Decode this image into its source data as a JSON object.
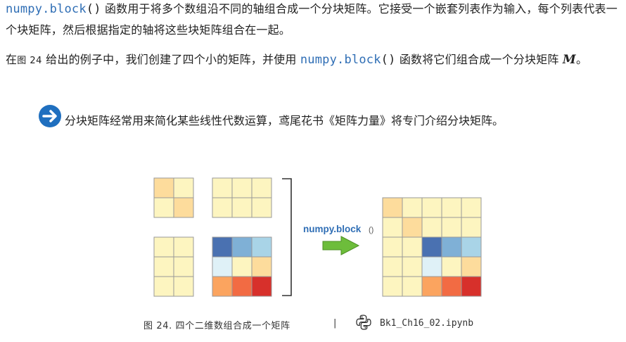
{
  "paragraph1": {
    "code": "numpy.block",
    "paren": "()",
    "text_a": " 函数用于将多个数组沿不同的轴组合成一个分块矩阵。它接受一个嵌套列表作为输入，每个列表代表一个块矩阵，然后根据指定的轴将这些块矩阵组合在一起。"
  },
  "paragraph2": {
    "prefix": "在",
    "fig_ref": "图 24",
    "text_a": " 给出的例子中，我们创建了四个小的矩阵，并使用 ",
    "code": "numpy.block",
    "paren": "()",
    "text_b": " 函数将它们组合成一个分块矩阵 ",
    "math": "M",
    "suffix": "。"
  },
  "note": {
    "icon": "arrow-right-circle-icon",
    "text": "分块矩阵经常用来简化某些线性代数运算，鸢尾花书《矩阵力量》将专门介绍分块矩阵。"
  },
  "figure": {
    "arrow_label_bold": "numpy.block",
    "arrow_label_paren": "()",
    "blocks": {
      "A": [
        [
          "#fddc9c",
          "#fdf5c0"
        ],
        [
          "#fdf5c0",
          "#fddc9c"
        ]
      ],
      "B": [
        [
          "#fdf5c0",
          "#fdf5c0",
          "#fdf5c0"
        ],
        [
          "#fdf5c0",
          "#fdf5c0",
          "#fdf5c0"
        ]
      ],
      "C": [
        [
          "#fdf5c0",
          "#fdf5c0"
        ],
        [
          "#fdf5c0",
          "#fdf5c0"
        ],
        [
          "#fdf5c0",
          "#fdf5c0"
        ]
      ],
      "D": [
        [
          "#4a71b1",
          "#7fb0d6",
          "#a9d4e7"
        ],
        [
          "#dff1f7",
          "#fdf5c0",
          "#fddc9c"
        ],
        [
          "#fba45f",
          "#f26b43",
          "#d7302b"
        ]
      ]
    },
    "colors": {
      "accent_blue": "#2f6eb5",
      "arrow_green": "#6dbd3b",
      "grid_line": "#999999"
    }
  },
  "caption": {
    "label": "图 24. 四个二维数组合成一个矩阵",
    "separator": "|",
    "icon": "python-icon",
    "file": "Bk1_Ch16_02.ipynb"
  }
}
